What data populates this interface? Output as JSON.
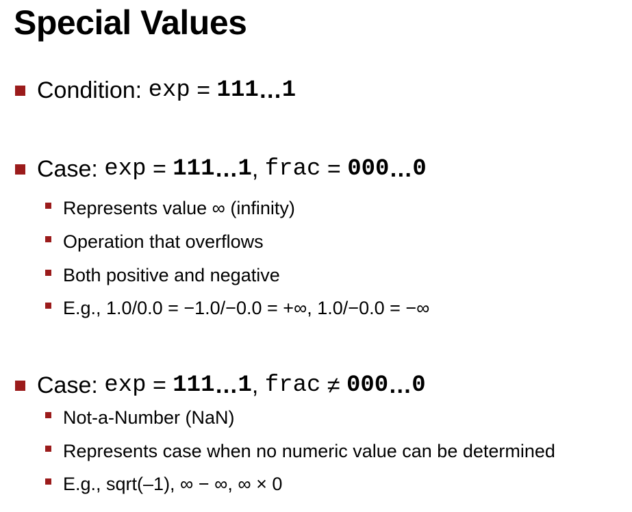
{
  "title": "Special Values",
  "condition": {
    "label": "Condition:",
    "field": "exp",
    "op": "=",
    "value_mono": "111",
    "value_ellipsis": "…",
    "value_end": "1"
  },
  "case_inf": {
    "label": "Case:",
    "field1": "exp",
    "op1": "=",
    "value1_mono": "111",
    "value1_ellipsis": "…",
    "value1_end": "1",
    "comma": ",",
    "field2": "frac",
    "op2": "=",
    "value2_mono": "000",
    "value2_ellipsis": "…",
    "value2_end": "0",
    "items": [
      "Represents value ∞ (infinity)",
      "Operation that overflows",
      "Both positive and negative",
      "E.g., 1.0/0.0 = −1.0/−0.0 = +∞,  1.0/−0.0 = −∞"
    ]
  },
  "case_nan": {
    "label": "Case:",
    "field1": "exp",
    "op1": "=",
    "value1_mono": "111",
    "value1_ellipsis": "…",
    "value1_end": "1",
    "comma": ",",
    "field2": "frac",
    "op2": "≠",
    "value2_mono": "000",
    "value2_ellipsis": "…",
    "value2_end": "0",
    "items": [
      "Not-a-Number (NaN)",
      "Represents case when no numeric value can be determined",
      "E.g., sqrt(–1), ∞ − ∞, ∞ × 0"
    ]
  },
  "colors": {
    "bullet": "#9b1b1b",
    "text": "#000000",
    "background": "#ffffff"
  }
}
